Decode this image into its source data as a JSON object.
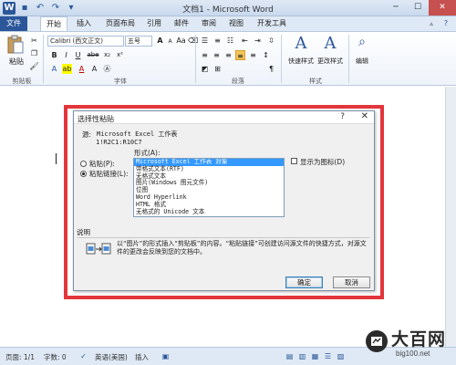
{
  "window": {
    "title": "文档1 - Microsoft Word",
    "controls": [
      "minimize",
      "maximize",
      "close"
    ]
  },
  "ribbon": {
    "tabs": [
      "文件",
      "开始",
      "插入",
      "页面布局",
      "引用",
      "邮件",
      "审阅",
      "视图",
      "开发工具"
    ],
    "active_tab": "开始",
    "clipboard": {
      "paste_label": "粘贴",
      "group_label": "剪贴板"
    },
    "font": {
      "font_name": "Calibri (西文正文)",
      "font_size": "五号",
      "group_label": "字体",
      "buttons": [
        "B",
        "I",
        "U",
        "abe",
        "x₂",
        "x²"
      ]
    },
    "paragraph": {
      "group_label": "段落"
    },
    "styles": {
      "quick_styles_label": "快速样式",
      "change_styles_label": "更改样式",
      "group_label": "样式"
    },
    "editing": {
      "label": "编辑"
    }
  },
  "dialog": {
    "title": "选择性粘贴",
    "help": "?",
    "close": "✕",
    "source_label": "源:",
    "source_value": "Microsoft Excel 工作表",
    "source_ref": "1!R2C1:R10C7",
    "as_label": "形式(A):",
    "options": [
      {
        "label": "粘贴(P):",
        "checked": false
      },
      {
        "label": "粘贴链接(L):",
        "checked": true
      }
    ],
    "formats": [
      "Microsoft Excel 工作表 对象",
      "带格式文本(RTF)",
      "无格式文本",
      "图片(Windows 图元文件)",
      "位图",
      "Word Hyperlink",
      "HTML 格式",
      "无格式的 Unicode 文本"
    ],
    "selected_format_index": 0,
    "display_as_icon": "显示为图标(D)",
    "desc_label": "说明",
    "description": "以“图片”的形式插入“剪贴板”的内容。“粘贴链接”可创建访问源文件的快捷方式，对源文件的更改会反映到您的文档中。",
    "ok": "确定",
    "cancel": "取消"
  },
  "status": {
    "page": "页面: 1/1",
    "words": "字数: 0",
    "language": "英语(美国)",
    "insert": "插入"
  },
  "watermark": {
    "title": "大百网",
    "url": "big100.net"
  },
  "colors": {
    "accent": "#2b579a",
    "highlight_frame": "#e2363b",
    "selection": "#3399ff"
  }
}
